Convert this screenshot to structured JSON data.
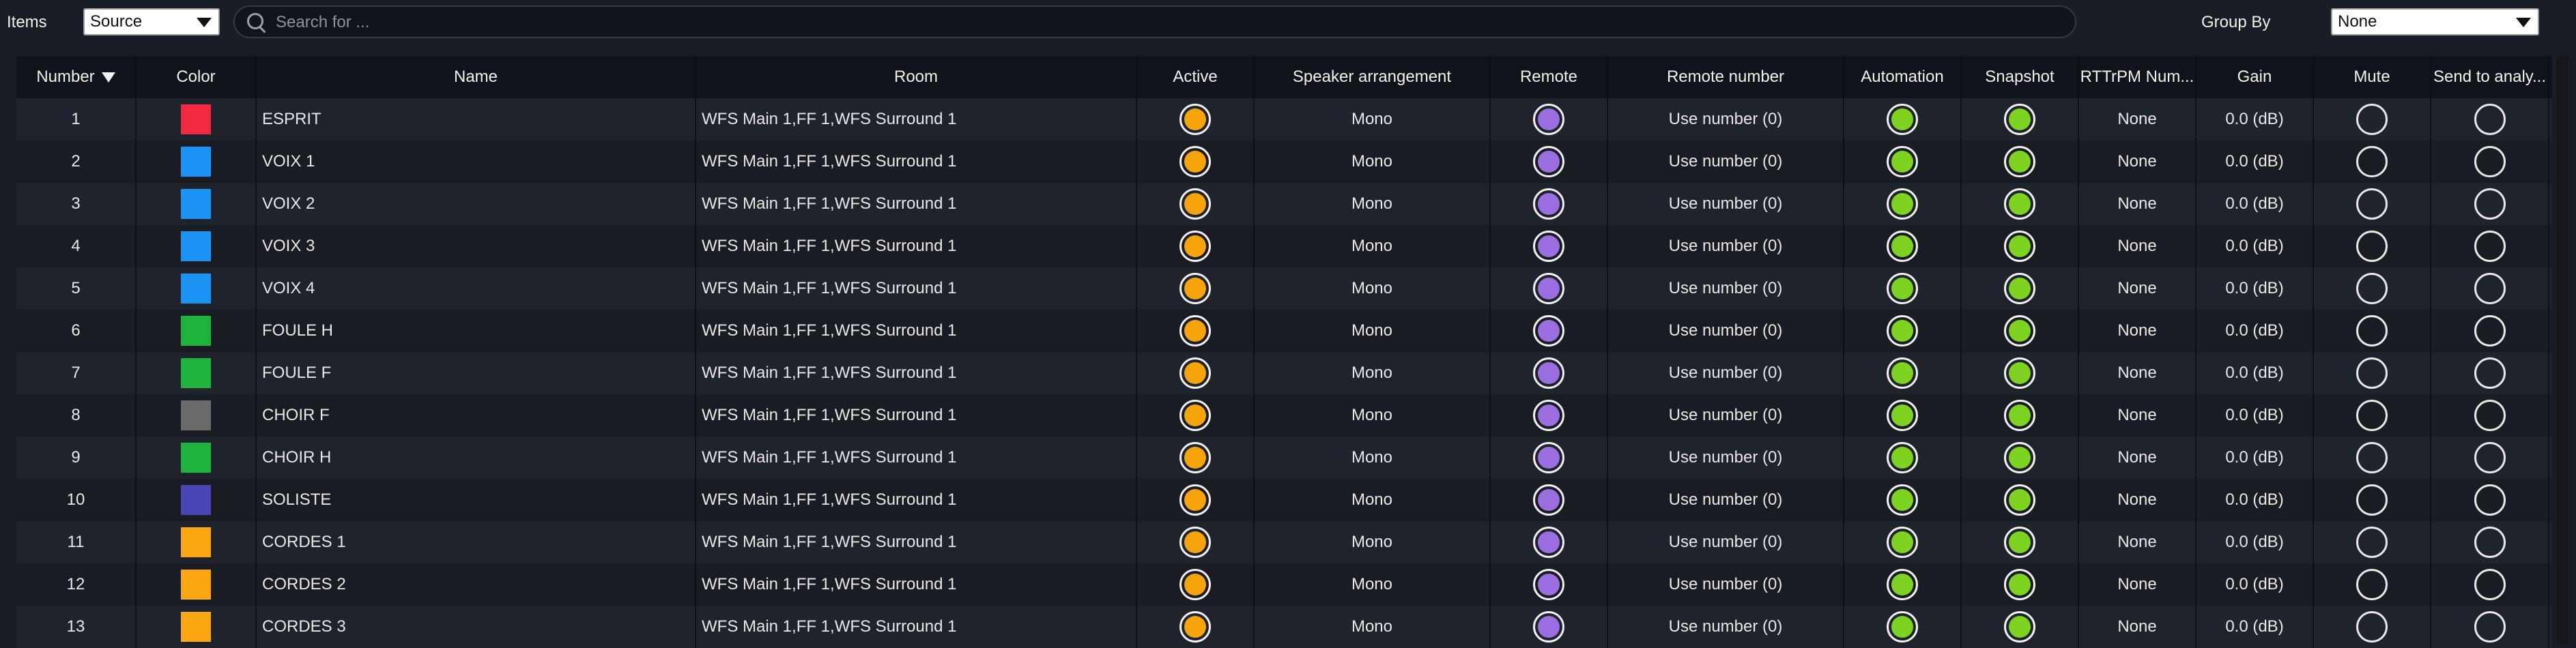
{
  "toolbar": {
    "items_label": "Items",
    "source_select_value": "Source",
    "search_placeholder": "Search for ...",
    "groupby_label": "Group By",
    "groupby_value": "None"
  },
  "colors": {
    "active": "#f5a50b",
    "remote": "#9b6ee0",
    "automation": "#7ed320",
    "snapshot": "#7ed320"
  },
  "table": {
    "columns": [
      {
        "key": "number",
        "label": "Number",
        "sorted": "desc"
      },
      {
        "key": "color",
        "label": "Color"
      },
      {
        "key": "name",
        "label": "Name"
      },
      {
        "key": "room",
        "label": "Room"
      },
      {
        "key": "active",
        "label": "Active"
      },
      {
        "key": "speaker",
        "label": "Speaker arrangement"
      },
      {
        "key": "remote",
        "label": "Remote"
      },
      {
        "key": "remote_number",
        "label": "Remote number"
      },
      {
        "key": "automation",
        "label": "Automation"
      },
      {
        "key": "snapshot",
        "label": "Snapshot"
      },
      {
        "key": "rttrpm",
        "label": "RTTrPM Num..."
      },
      {
        "key": "gain",
        "label": "Gain"
      },
      {
        "key": "mute",
        "label": "Mute"
      },
      {
        "key": "send",
        "label": "Send to analy..."
      }
    ],
    "rows": [
      {
        "number": "1",
        "color": "#f2293f",
        "name": "ESPRIT",
        "room": "WFS Main 1,FF 1,WFS Surround 1",
        "active": true,
        "speaker": "Mono",
        "remote": true,
        "remote_number": "Use number (0)",
        "automation": true,
        "snapshot": true,
        "rttrpm": "None",
        "gain": "0.0 (dB)",
        "mute": false,
        "send": false
      },
      {
        "number": "2",
        "color": "#1a93f5",
        "name": "VOIX 1",
        "room": "WFS Main 1,FF 1,WFS Surround 1",
        "active": true,
        "speaker": "Mono",
        "remote": true,
        "remote_number": "Use number (0)",
        "automation": true,
        "snapshot": true,
        "rttrpm": "None",
        "gain": "0.0 (dB)",
        "mute": false,
        "send": false
      },
      {
        "number": "3",
        "color": "#1a93f5",
        "name": "VOIX 2",
        "room": "WFS Main 1,FF 1,WFS Surround 1",
        "active": true,
        "speaker": "Mono",
        "remote": true,
        "remote_number": "Use number (0)",
        "automation": true,
        "snapshot": true,
        "rttrpm": "None",
        "gain": "0.0 (dB)",
        "mute": false,
        "send": false
      },
      {
        "number": "4",
        "color": "#1a93f5",
        "name": "VOIX 3",
        "room": "WFS Main 1,FF 1,WFS Surround 1",
        "active": true,
        "speaker": "Mono",
        "remote": true,
        "remote_number": "Use number (0)",
        "automation": true,
        "snapshot": true,
        "rttrpm": "None",
        "gain": "0.0 (dB)",
        "mute": false,
        "send": false
      },
      {
        "number": "5",
        "color": "#1a93f5",
        "name": "VOIX 4",
        "room": "WFS Main 1,FF 1,WFS Surround 1",
        "active": true,
        "speaker": "Mono",
        "remote": true,
        "remote_number": "Use number (0)",
        "automation": true,
        "snapshot": true,
        "rttrpm": "None",
        "gain": "0.0 (dB)",
        "mute": false,
        "send": false
      },
      {
        "number": "6",
        "color": "#1db33c",
        "name": "FOULE H",
        "room": "WFS Main 1,FF 1,WFS Surround 1",
        "active": true,
        "speaker": "Mono",
        "remote": true,
        "remote_number": "Use number (0)",
        "automation": true,
        "snapshot": true,
        "rttrpm": "None",
        "gain": "0.0 (dB)",
        "mute": false,
        "send": false
      },
      {
        "number": "7",
        "color": "#1db33c",
        "name": "FOULE F",
        "room": "WFS Main 1,FF 1,WFS Surround 1",
        "active": true,
        "speaker": "Mono",
        "remote": true,
        "remote_number": "Use number (0)",
        "automation": true,
        "snapshot": true,
        "rttrpm": "None",
        "gain": "0.0 (dB)",
        "mute": false,
        "send": false
      },
      {
        "number": "8",
        "color": "#6b6b6b",
        "name": "CHOIR F",
        "room": "WFS Main 1,FF 1,WFS Surround 1",
        "active": true,
        "speaker": "Mono",
        "remote": true,
        "remote_number": "Use number (0)",
        "automation": true,
        "snapshot": true,
        "rttrpm": "None",
        "gain": "0.0 (dB)",
        "mute": false,
        "send": false
      },
      {
        "number": "9",
        "color": "#1db33c",
        "name": "CHOIR H",
        "room": "WFS Main 1,FF 1,WFS Surround 1",
        "active": true,
        "speaker": "Mono",
        "remote": true,
        "remote_number": "Use number (0)",
        "automation": true,
        "snapshot": true,
        "rttrpm": "None",
        "gain": "0.0 (dB)",
        "mute": false,
        "send": false
      },
      {
        "number": "10",
        "color": "#4a46b8",
        "name": "SOLISTE",
        "room": "WFS Main 1,FF 1,WFS Surround 1",
        "active": true,
        "speaker": "Mono",
        "remote": true,
        "remote_number": "Use number (0)",
        "automation": true,
        "snapshot": true,
        "rttrpm": "None",
        "gain": "0.0 (dB)",
        "mute": false,
        "send": false
      },
      {
        "number": "11",
        "color": "#fca712",
        "name": "CORDES 1",
        "room": "WFS Main 1,FF 1,WFS Surround 1",
        "active": true,
        "speaker": "Mono",
        "remote": true,
        "remote_number": "Use number (0)",
        "automation": true,
        "snapshot": true,
        "rttrpm": "None",
        "gain": "0.0 (dB)",
        "mute": false,
        "send": false
      },
      {
        "number": "12",
        "color": "#fca712",
        "name": "CORDES 2",
        "room": "WFS Main 1,FF 1,WFS Surround 1",
        "active": true,
        "speaker": "Mono",
        "remote": true,
        "remote_number": "Use number (0)",
        "automation": true,
        "snapshot": true,
        "rttrpm": "None",
        "gain": "0.0 (dB)",
        "mute": false,
        "send": false
      },
      {
        "number": "13",
        "color": "#fca712",
        "name": "CORDES 3",
        "room": "WFS Main 1,FF 1,WFS Surround 1",
        "active": true,
        "speaker": "Mono",
        "remote": true,
        "remote_number": "Use number (0)",
        "automation": true,
        "snapshot": true,
        "rttrpm": "None",
        "gain": "0.0 (dB)",
        "mute": false,
        "send": false
      }
    ]
  }
}
